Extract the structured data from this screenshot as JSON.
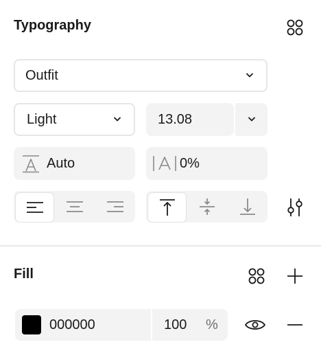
{
  "typography": {
    "title": "Typography",
    "font_family": "Outfit",
    "font_weight": "Light",
    "font_size": "13.08",
    "line_height": "Auto",
    "letter_spacing": "0%",
    "text_align": {
      "options": [
        "left",
        "center",
        "right"
      ],
      "selected": "left"
    },
    "vertical_align": {
      "options": [
        "top",
        "middle",
        "bottom"
      ],
      "selected": "top"
    }
  },
  "fill": {
    "title": "Fill",
    "color_hex": "000000",
    "swatch_color": "#000000",
    "opacity": "100",
    "opacity_unit": "%"
  }
}
